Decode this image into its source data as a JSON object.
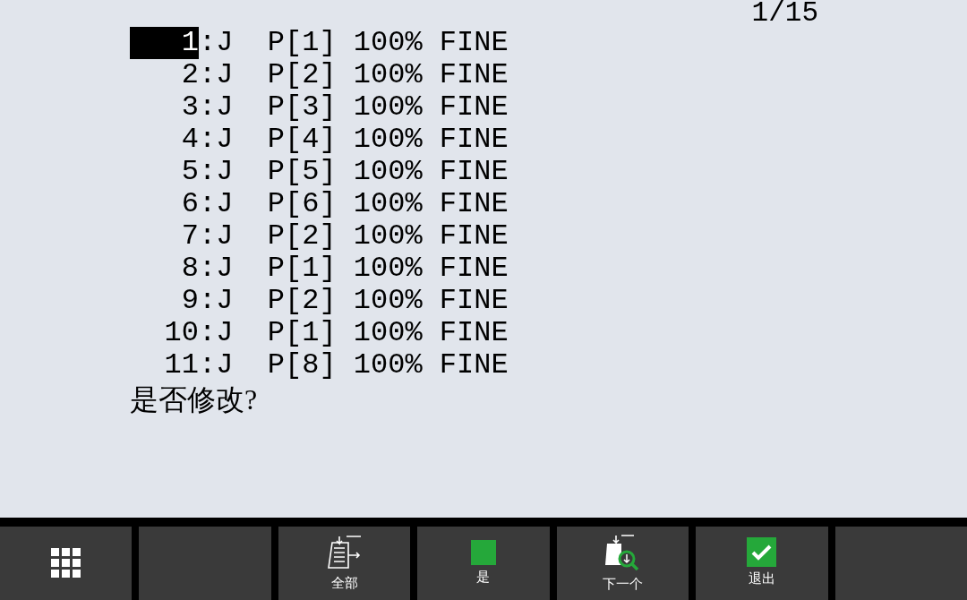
{
  "page_counter": "1/15",
  "program_lines": [
    {
      "number": "1",
      "instruction": ":J  P[1] 100% FINE",
      "selected": true
    },
    {
      "number": "2",
      "instruction": ":J  P[2] 100% FINE",
      "selected": false
    },
    {
      "number": "3",
      "instruction": ":J  P[3] 100% FINE",
      "selected": false
    },
    {
      "number": "4",
      "instruction": ":J  P[4] 100% FINE",
      "selected": false
    },
    {
      "number": "5",
      "instruction": ":J  P[5] 100% FINE",
      "selected": false
    },
    {
      "number": "6",
      "instruction": ":J  P[6] 100% FINE",
      "selected": false
    },
    {
      "number": "7",
      "instruction": ":J  P[2] 100% FINE",
      "selected": false
    },
    {
      "number": "8",
      "instruction": ":J  P[1] 100% FINE",
      "selected": false
    },
    {
      "number": "9",
      "instruction": ":J  P[2] 100% FINE",
      "selected": false
    },
    {
      "number": "10",
      "instruction": ":J  P[1] 100% FINE",
      "selected": false
    },
    {
      "number": "11",
      "instruction": ":J  P[8] 100% FINE",
      "selected": false
    }
  ],
  "prompt": "是否修改?",
  "softkeys": [
    {
      "kind": "menu"
    },
    {
      "kind": "blank"
    },
    {
      "kind": "all",
      "label": "全部"
    },
    {
      "kind": "yes",
      "label": "是"
    },
    {
      "kind": "next",
      "label": "下一个"
    },
    {
      "kind": "exit",
      "label": "退出"
    },
    {
      "kind": "blank"
    }
  ]
}
